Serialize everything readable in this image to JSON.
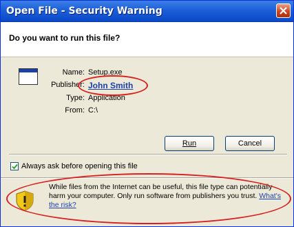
{
  "window": {
    "title": "Open File - Security Warning"
  },
  "header": {
    "question": "Do you want to run this file?"
  },
  "file_info": {
    "name_label": "Name:",
    "name_value": "Setup.exe",
    "publisher_label": "Publisher:",
    "publisher_value": "John Smith",
    "type_label": "Type:",
    "type_value": "Application",
    "from_label": "From:",
    "from_value": "C:\\"
  },
  "buttons": {
    "run_label": "Run",
    "cancel_label": "Cancel"
  },
  "checkbox": {
    "label": "Always ask before opening this file",
    "checked": true
  },
  "warning": {
    "text": "While files from the Internet can be useful, this file type can potentially harm your computer. Only run software from publishers you trust.",
    "link_text": "What's the risk?"
  },
  "colors": {
    "titlebar": "#1d5fd9",
    "highlight": "#d62020",
    "link": "#1c3fa8",
    "background": "#ece9d8"
  }
}
